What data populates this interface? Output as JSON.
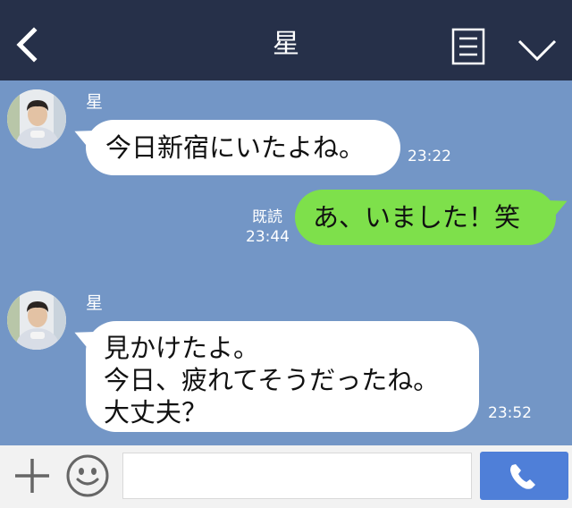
{
  "header": {
    "title": "星",
    "back_icon": "chevron-left-icon",
    "memo_icon": "note-icon",
    "menu_icon": "chevron-down-icon"
  },
  "messages": [
    {
      "sender": "星",
      "text": "今日新宿にいたよね。",
      "time": "23:22",
      "direction": "incoming"
    },
    {
      "text": "あ、いました！笑",
      "read_label": "既読",
      "time": "23:44",
      "direction": "outgoing"
    },
    {
      "sender": "星",
      "text": "見かけたよ。\n今日、疲れてそうだったね。\n大丈夫？",
      "time": "23:52",
      "direction": "incoming"
    }
  ],
  "composer": {
    "plus_icon": "plus-icon",
    "emoji_icon": "smiley-icon",
    "send_icon": "phone-icon",
    "input_value": ""
  },
  "colors": {
    "header_bg": "#263049",
    "chat_bg": "#7396c6",
    "incoming_bubble": "#ffffff",
    "outgoing_bubble": "#7ee04b",
    "call_button": "#4f7fd8"
  }
}
